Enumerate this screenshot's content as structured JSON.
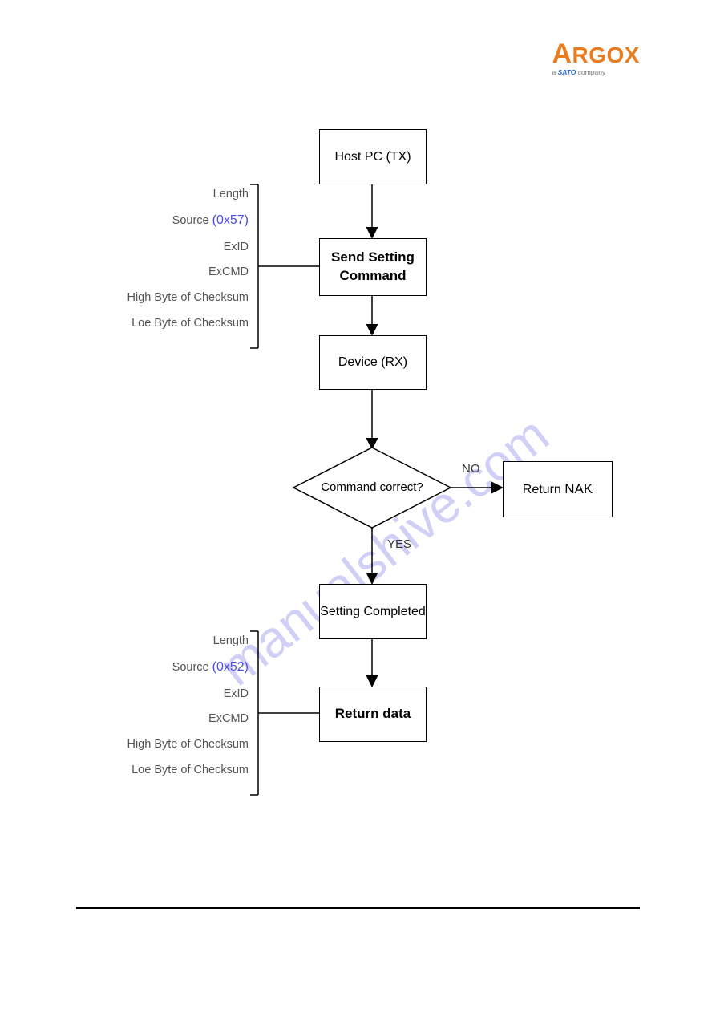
{
  "logo": {
    "brand_first": "A",
    "brand_rest": "RGOX",
    "sub_prefix": "a ",
    "sub_brand": "SATO",
    "sub_suffix": " company"
  },
  "nodes": {
    "host_pc": "Host PC (TX)",
    "send_setting": "Send Setting\nCommand",
    "device_rx": "Device (RX)",
    "decision": "Command correct?",
    "return_nak_a": "Return",
    "return_nak_b": "NAK",
    "setting_completed": "Setting Completed",
    "return_data": "Return data"
  },
  "edges": {
    "no": "NO",
    "yes": "YES"
  },
  "bracket1": {
    "length": "Length",
    "source_label": "Source ",
    "source_hex": "(0x57)",
    "exid": "ExID",
    "excmd": "ExCMD",
    "hi_cs": "High Byte of Checksum",
    "lo_cs": "Loe Byte of Checksum"
  },
  "bracket2": {
    "length": "Length",
    "source_label": "Source ",
    "source_hex": "(0x52)",
    "exid": "ExID",
    "excmd": "ExCMD",
    "hi_cs": "High Byte of Checksum",
    "lo_cs": "Loe Byte of Checksum"
  },
  "watermark": "manualshive.com",
  "chart_data": {
    "type": "flowchart",
    "title": "",
    "nodes": [
      {
        "id": "host",
        "kind": "process",
        "label": "Host PC (TX)"
      },
      {
        "id": "send",
        "kind": "process",
        "label": "Send Setting Command",
        "annotation_left": [
          "Length",
          "Source (0x57)",
          "ExID",
          "ExCMD",
          "High Byte of Checksum",
          "Loe Byte of Checksum"
        ]
      },
      {
        "id": "device",
        "kind": "process",
        "label": "Device (RX)"
      },
      {
        "id": "dec",
        "kind": "decision",
        "label": "Command correct?"
      },
      {
        "id": "nak",
        "kind": "process",
        "label": "Return NAK"
      },
      {
        "id": "done",
        "kind": "process",
        "label": "Setting Completed"
      },
      {
        "id": "ret",
        "kind": "process",
        "label": "Return data",
        "annotation_left": [
          "Length",
          "Source (0x52)",
          "ExID",
          "ExCMD",
          "High Byte of Checksum",
          "Loe Byte of Checksum"
        ]
      }
    ],
    "edges": [
      {
        "from": "host",
        "to": "send"
      },
      {
        "from": "send",
        "to": "device"
      },
      {
        "from": "device",
        "to": "dec"
      },
      {
        "from": "dec",
        "to": "nak",
        "label": "NO"
      },
      {
        "from": "dec",
        "to": "done",
        "label": "YES"
      },
      {
        "from": "done",
        "to": "ret"
      }
    ]
  }
}
